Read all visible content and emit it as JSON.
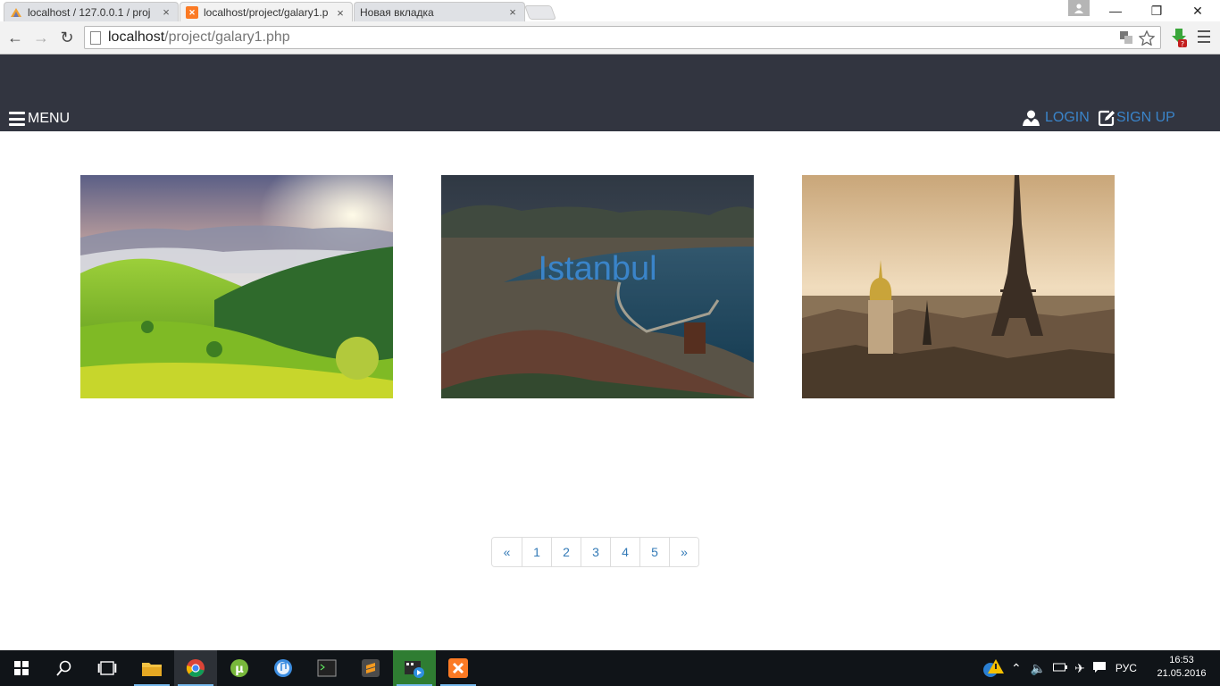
{
  "browser": {
    "tabs": [
      {
        "title": "localhost / 127.0.0.1 / proj",
        "close": "×",
        "favicon": "phpmyadmin-icon"
      },
      {
        "title": "localhost/project/galary1.p",
        "close": "×",
        "favicon": "xampp-icon",
        "active": true
      },
      {
        "title": "Новая вкладка",
        "close": "×",
        "favicon": "none"
      }
    ],
    "address": {
      "host": "localhost",
      "path": "/project/galary1.php"
    },
    "window_controls": {
      "minimize": "—",
      "restore": "❐",
      "close": "✕"
    },
    "nav": {
      "back": "←",
      "forward": "→",
      "reload": "↻"
    }
  },
  "site": {
    "header": {
      "menu_label": "MENU",
      "login_label": "LOGIN",
      "signup_label": "SIGN UP",
      "background": "#323540",
      "link_color": "#3a84c9"
    },
    "gallery": [
      {
        "name": "mountain-valley",
        "caption": ""
      },
      {
        "name": "coastal-city",
        "caption": "Istanbul"
      },
      {
        "name": "paris-skyline",
        "caption": ""
      }
    ],
    "pagination": {
      "prev": "«",
      "pages": [
        "1",
        "2",
        "3",
        "4",
        "5"
      ],
      "next": "»"
    }
  },
  "taskbar": {
    "apps": [
      "start-icon",
      "search-icon",
      "task-view-icon",
      "file-explorer-icon",
      "chrome-icon",
      "utorrent-icon",
      "itunes-icon",
      "terminal-icon",
      "sublime-icon",
      "video-editor-icon",
      "xampp-icon"
    ],
    "tray": {
      "language": "РУС"
    },
    "clock": {
      "time": "16:53",
      "date": "21.05.2016"
    }
  }
}
